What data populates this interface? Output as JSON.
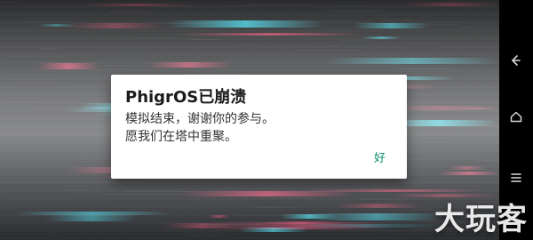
{
  "navbar": {
    "back_icon": "back-icon",
    "home_icon": "home-icon",
    "menu_icon": "menu-icon"
  },
  "dialog": {
    "title": "PhigrOS已崩溃",
    "message_lines": [
      "模拟结束，谢谢你的参与。",
      "愿我们在塔中重聚。"
    ],
    "ok_label": "好"
  },
  "watermark": {
    "text": "大玩客"
  },
  "colors": {
    "dialog_bg": "#ffffff",
    "ok_text": "#0a8f6a",
    "navbar_bg": "#000000",
    "glitch_red": "#ff2a5a",
    "glitch_cyan": "#22e6ff"
  }
}
